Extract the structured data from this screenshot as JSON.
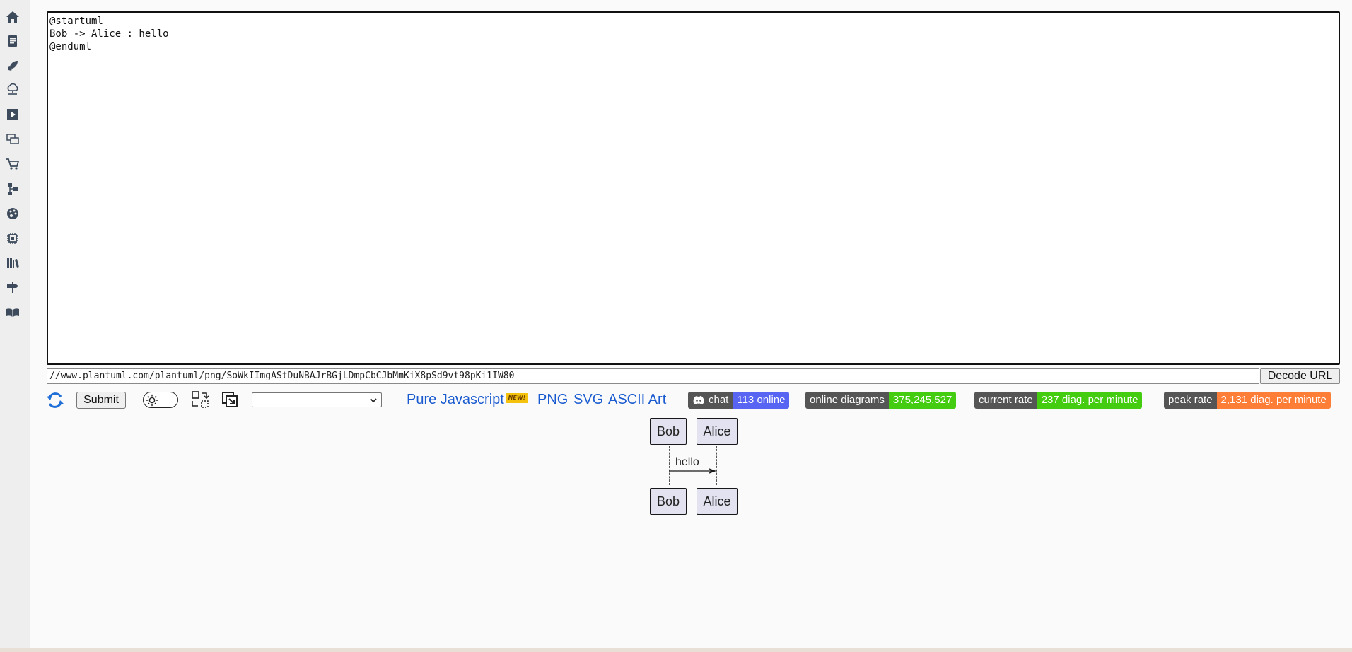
{
  "sidebar": {
    "items": [
      {
        "icon": "home-icon"
      },
      {
        "icon": "document-icon"
      },
      {
        "icon": "rocket-icon"
      },
      {
        "icon": "cloud-server-icon"
      },
      {
        "icon": "play-icon"
      },
      {
        "icon": "chat-icon"
      },
      {
        "icon": "cart-icon"
      },
      {
        "icon": "sitemap-icon"
      },
      {
        "icon": "palette-icon"
      },
      {
        "icon": "chip-icon"
      },
      {
        "icon": "library-icon"
      },
      {
        "icon": "signpost-icon"
      },
      {
        "icon": "book-icon"
      }
    ]
  },
  "editor": {
    "content": "@startuml\nBob -> Alice : hello\n@enduml"
  },
  "url_bar": {
    "value": "//www.plantuml.com/plantuml/png/SoWkIImgAStDuNBAJrBGjLDmpCbCJbMmKiX8pSd9vt98pKi1IW80",
    "decode_label": "Decode URL"
  },
  "toolbar": {
    "submit_label": "Submit",
    "select_value": "",
    "formats": {
      "pure_js": "Pure Javascript",
      "new_badge": "NEW!",
      "png": "PNG",
      "svg": "SVG",
      "ascii": "ASCII Art"
    }
  },
  "stats": {
    "chat": {
      "label": "chat",
      "value": "113 online",
      "color": "#5865f2"
    },
    "online": {
      "label": "online diagrams",
      "value": "375,245,527",
      "color": "#44cc11"
    },
    "current": {
      "label": "current rate",
      "value": "237 diag. per minute",
      "color": "#44cc11"
    },
    "peak": {
      "label": "peak rate",
      "value": "2,131 diag. per minute",
      "color": "#fe7d37"
    }
  },
  "diagram": {
    "participants": [
      "Bob",
      "Alice"
    ],
    "message": "hello"
  }
}
